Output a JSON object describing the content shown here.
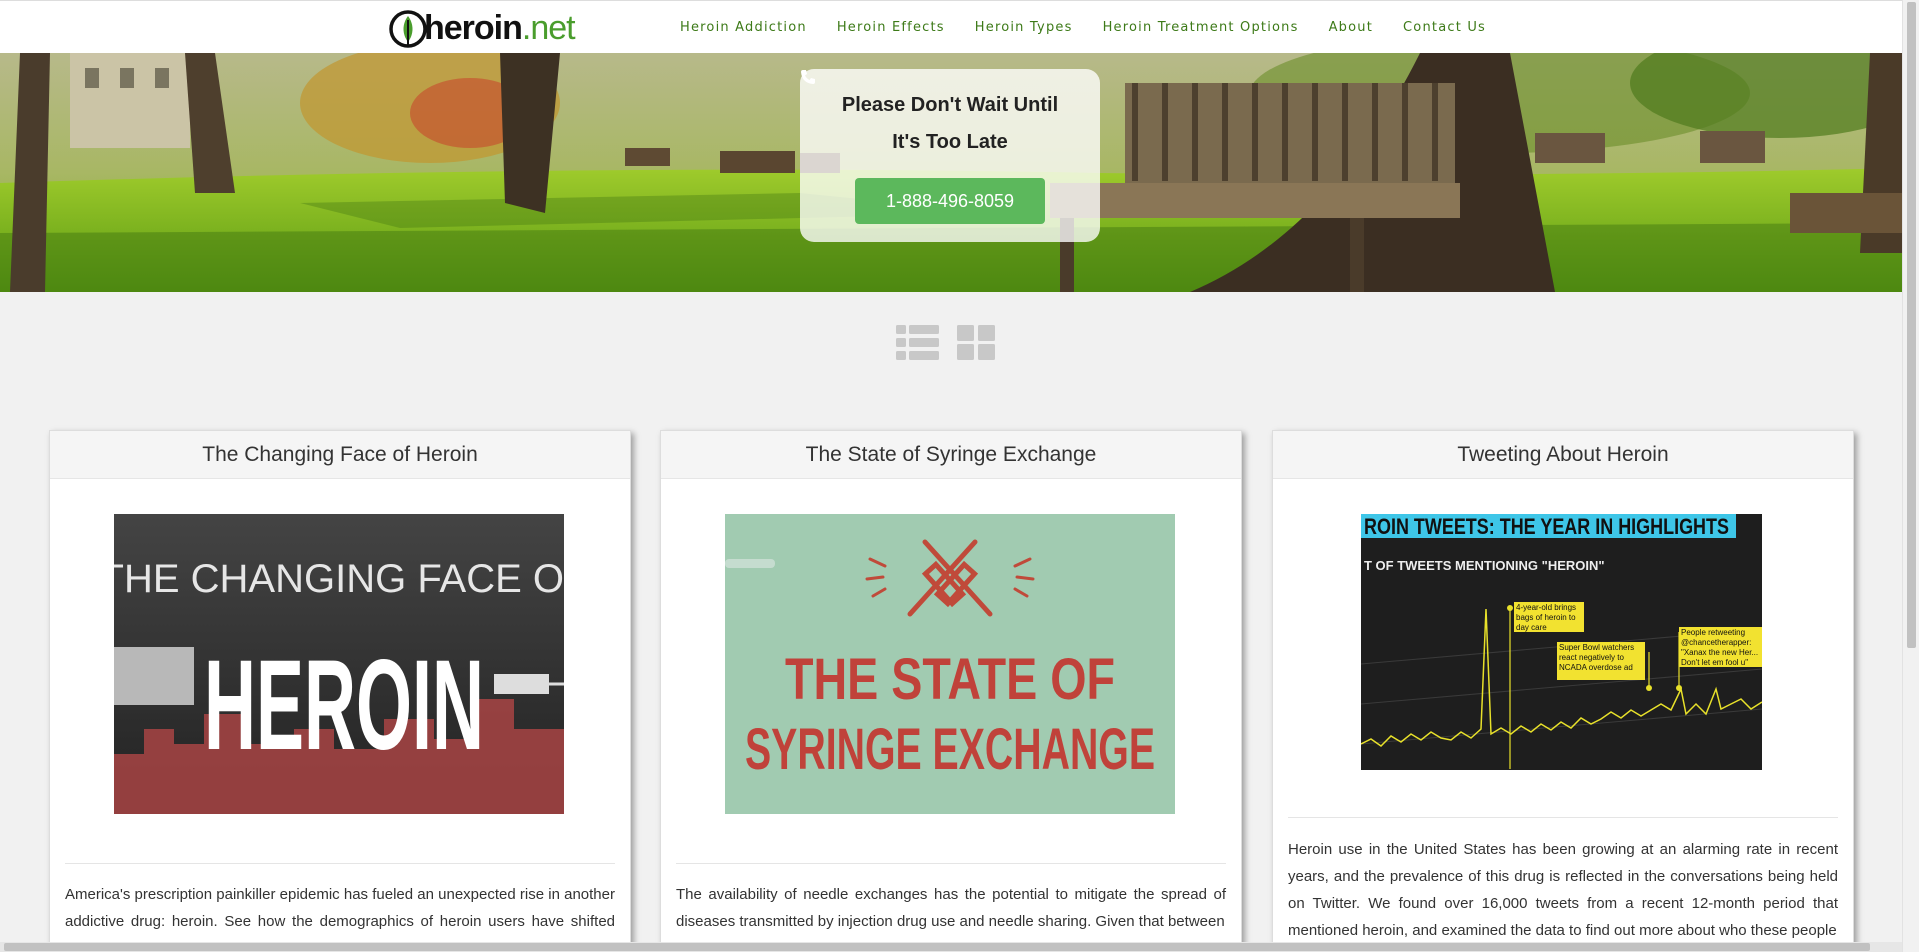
{
  "header": {
    "logo_main": "heroin",
    "logo_tld": ".net",
    "nav": [
      {
        "label": "Heroin Addiction"
      },
      {
        "label": "Heroin Effects"
      },
      {
        "label": "Heroin Types"
      },
      {
        "label": "Heroin Treatment Options"
      },
      {
        "label": "About"
      },
      {
        "label": "Contact Us"
      }
    ]
  },
  "hero": {
    "line1": "Please Don't Wait Until",
    "line2": "It's Too Late",
    "phone": "1-888-496-8059",
    "button_color": "#5cb85c"
  },
  "view_toggles": [
    {
      "icon": "list-view-icon"
    },
    {
      "icon": "grid-view-icon"
    }
  ],
  "cards": [
    {
      "title": "The Changing Face of Heroin",
      "image_line1": "THE CHANGING FACE OF",
      "image_line2": "HEROIN",
      "text": "America's prescription painkiller epidemic has fueled an unexpected rise in another addictive drug: heroin. See how the demographics of heroin users have shifted over"
    },
    {
      "title": "The State of Syringe Exchange",
      "image_line1": "THE STATE OF",
      "image_line2": "SYRINGE EXCHANGE",
      "text": "The availability of needle exchanges has the potential to mitigate the spread of diseases transmitted by injection drug use and needle sharing. Given that between"
    },
    {
      "title": "Tweeting About Heroin",
      "image_banner": "ROIN TWEETS: THE YEAR IN HIGHLIGHTS",
      "image_subtitle": "T OF TWEETS MENTIONING \"HEROIN\"",
      "image_callouts": [
        "4-year-old brings bags of heroin to day care",
        "Super Bowl watchers react negatively to NCADA overdose ad",
        "People retweeting @chancetherapper: \"Xanax the new Her... Don't let em fool u\""
      ],
      "text": "Heroin use in the United States has been growing at an alarming rate in recent years, and the prevalence of this drug is reflected in the conversations being held on Twitter. We found over 16,000 tweets from a recent 12-month period that mentioned heroin, and examined the data to find out more about who these people"
    }
  ]
}
